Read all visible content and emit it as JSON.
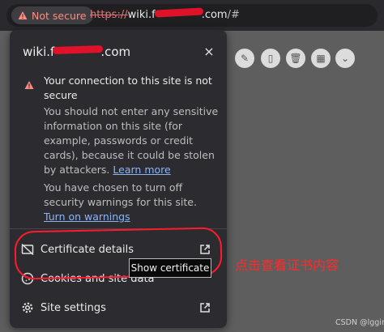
{
  "address_bar": {
    "security_chip": "Not secure",
    "url_scheme": "https://",
    "url_host_prefix": "wiki.f",
    "url_host_suffix": ".com",
    "url_rest": "/#"
  },
  "popup": {
    "site_prefix": "wiki.f",
    "site_suffix": ".com",
    "close_glyph": "×",
    "warning_title": "Your connection to this site is not secure",
    "warning_body": "You should not enter any sensitive information on this site (for example, passwords or credit cards), because it could be stolen by attackers.",
    "learn_more": "Learn more",
    "turned_off_text": "You have chosen to turn off security warnings for this site.",
    "turn_on_warnings": "Turn on warnings",
    "rows": [
      {
        "label": "Certificate details",
        "icon": "certificate-icon"
      },
      {
        "label": "Cookies and site data",
        "icon": "cookie-icon"
      },
      {
        "label": "Site settings",
        "icon": "gear-icon"
      }
    ]
  },
  "tooltip": "Show certificate",
  "annotation": "点击查看证书内容",
  "watermark": "CSDN @lggirls",
  "colors": {
    "popup_bg": "#2c2c30",
    "link": "#8ab4f8",
    "danger": "#ff8a80",
    "annotation_red": "#ff1a2e"
  }
}
